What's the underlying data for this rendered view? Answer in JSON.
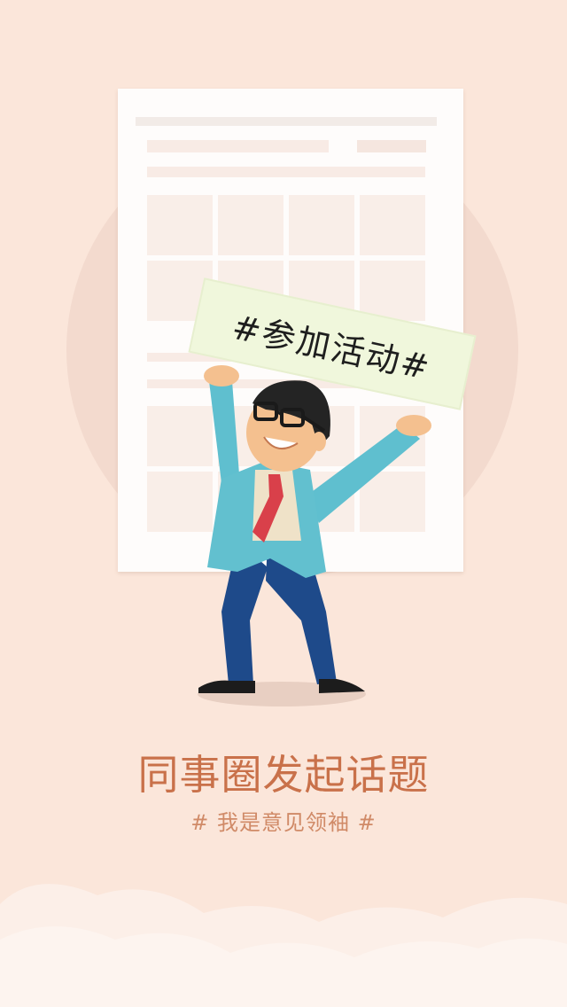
{
  "sign": {
    "text": "#参加活动#"
  },
  "title": "同事圈发起话题",
  "subtitle": "# 我是意见领袖 #",
  "colors": {
    "background": "#fbe6da",
    "circle": "#f3dace",
    "title": "#c9714a",
    "subtitle": "#d08a67"
  }
}
